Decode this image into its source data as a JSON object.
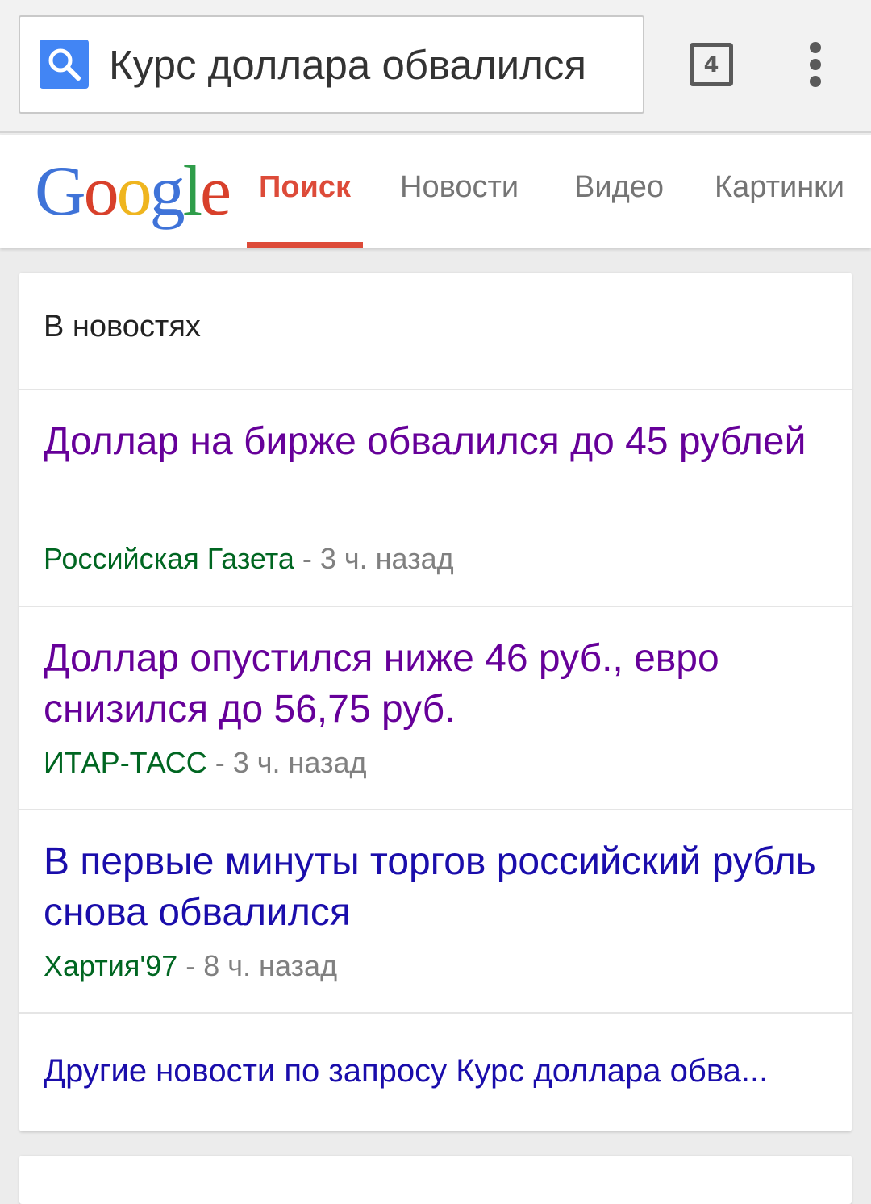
{
  "browser": {
    "omnibox_query": "Курс доллара обвалился",
    "tab_count": "4",
    "search_icon": "search-icon",
    "menu_icon": "overflow-menu-icon",
    "accent_color": "#4285f4"
  },
  "google": {
    "logo": [
      "G",
      "o",
      "o",
      "g",
      "l",
      "e"
    ],
    "logo_colors": [
      "#3f73d8",
      "#d8402b",
      "#efb51f",
      "#3f73d8",
      "#2f9d4a",
      "#d8402b"
    ],
    "tabs": [
      {
        "label": "Поиск",
        "active": true
      },
      {
        "label": "Новости",
        "active": false
      },
      {
        "label": "Видео",
        "active": false
      },
      {
        "label": "Картинки",
        "active": false
      }
    ],
    "active_tab_color": "#dd4b39"
  },
  "news": {
    "title": "В новостях",
    "items": [
      {
        "headline": "Доллар на бирже обвалился до 45 рублей",
        "source": "Российская Газета",
        "time": " - 3 ч. назад",
        "visited": true
      },
      {
        "headline": "Доллар опустился ниже 46 руб., евро снизился до 56,75 руб.",
        "source": "ИТАР-ТАСС",
        "time": " - 3 ч. назад",
        "visited": true
      },
      {
        "headline": "В первые минуты торгов российский рубль снова обвалился",
        "source": "Хартия'97",
        "time": " - 8 ч. назад",
        "visited": false
      }
    ],
    "more_link": "Другие новости по запросу Курс доллара обва...",
    "visited_color": "#660099",
    "link_color": "#1a0dab",
    "source_color": "#006621"
  }
}
